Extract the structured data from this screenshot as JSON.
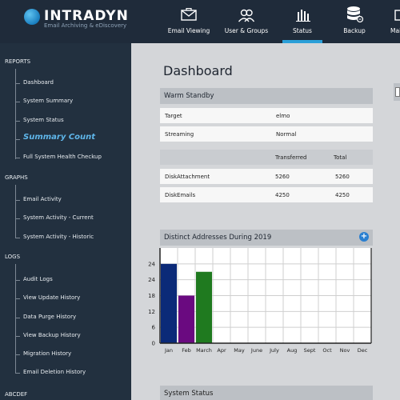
{
  "header": {
    "brand": "INTRADYN",
    "brand_sub": "Email Archiving & eDiscovery",
    "nav": [
      {
        "label": "Email Viewing",
        "icon": "envelope-icon"
      },
      {
        "label": "User & Groups",
        "icon": "users-icon"
      },
      {
        "label": "Status",
        "icon": "bar-chart-icon",
        "active": true
      },
      {
        "label": "Backup",
        "icon": "database-icon"
      },
      {
        "label": "Mai",
        "icon": "mail-icon"
      }
    ]
  },
  "sidebar": {
    "sections": [
      {
        "title": "REPORTS",
        "items": [
          "Dashboard",
          "System Summary",
          "System Status",
          "Summary Count",
          "Full System Health Checkup"
        ]
      },
      {
        "title": "GRAPHS",
        "items": [
          "Email Activity",
          "System Activity - Current",
          "System Activity - Historic"
        ]
      },
      {
        "title": "LOGS",
        "items": [
          "Audit Logs",
          "View Update History",
          "Data Purge History",
          "View Backup History",
          "Migration History",
          "Email Deletion History"
        ]
      },
      {
        "title": "ABCDEF",
        "items": []
      }
    ],
    "active_item": "Summary Count"
  },
  "main": {
    "title": "Dashboard",
    "warm_standby": {
      "heading": "Warm Standby",
      "rows": [
        {
          "label": "Target",
          "value": "elmo"
        },
        {
          "label": "Streaming",
          "value": "Normal"
        }
      ]
    },
    "transfer_table": {
      "headers": [
        "",
        "Transferred",
        "Total"
      ],
      "rows": [
        {
          "name": "DiskAttachment",
          "transferred": "5260",
          "total": "5260"
        },
        {
          "name": "DiskEmails",
          "transferred": "4250",
          "total": "4250"
        }
      ]
    },
    "distinct_addresses": {
      "heading": "Distinct Addresses During 2019"
    },
    "system_status": {
      "heading": "System Status"
    }
  },
  "chart_data": {
    "type": "bar",
    "title": "Distinct Addresses During 2019",
    "categories": [
      "Jan",
      "Feb",
      "March",
      "Apr",
      "May",
      "June",
      "July",
      "Aug",
      "Sept",
      "Oct",
      "Nov",
      "Dec"
    ],
    "values": [
      30,
      18,
      27,
      0,
      0,
      0,
      0,
      0,
      0,
      0,
      0,
      0
    ],
    "bar_colors": [
      "#0b2a78",
      "#6a0a80",
      "#1f7a1f"
    ],
    "ytick_labels": [
      "0",
      "6",
      "12",
      "18",
      "24",
      "24"
    ],
    "ylim": [
      0,
      36
    ],
    "grid": true,
    "xlabel": "",
    "ylabel": ""
  }
}
